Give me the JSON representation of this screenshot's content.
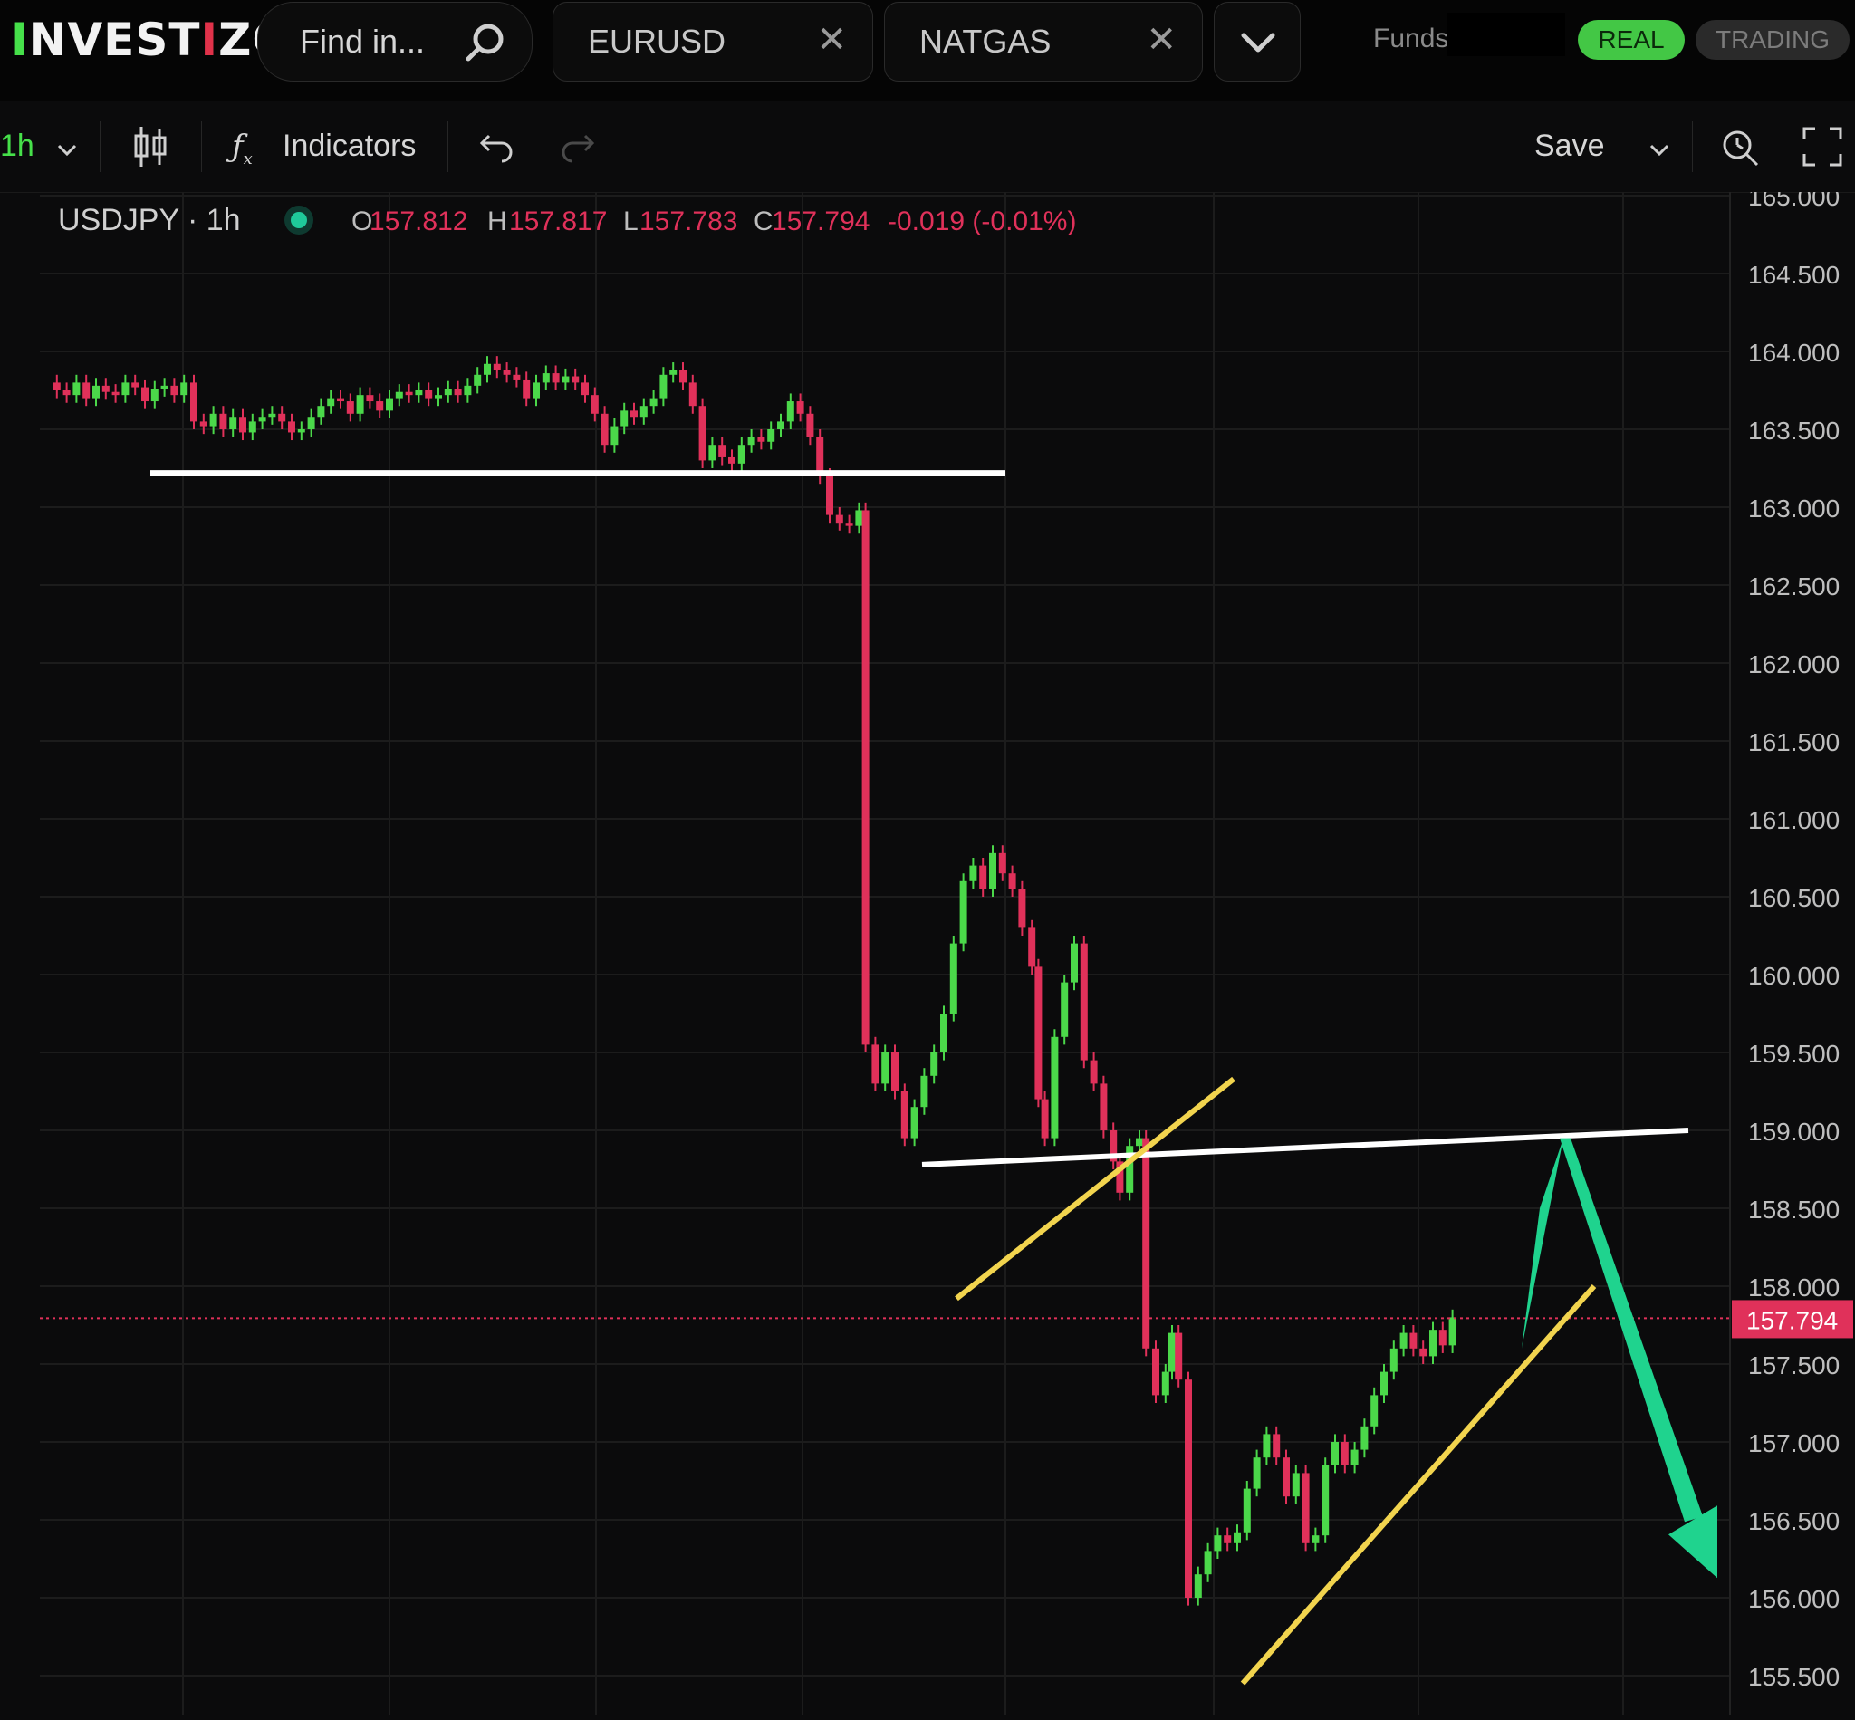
{
  "app": {
    "logo": "INVESTIZO"
  },
  "header": {
    "search_placeholder": "Find in...",
    "tabs": [
      {
        "label": "EURUSD"
      },
      {
        "label": "NATGAS"
      }
    ],
    "funds_label": "Funds",
    "real_label": "REAL",
    "trading_label": "TRADING"
  },
  "toolbar": {
    "interval": "1h",
    "indicators_label": "Indicators",
    "save_label": "Save"
  },
  "legend": {
    "symbol": "USDJPY · 1h",
    "o_label": "O",
    "o": "157.812",
    "h_label": "H",
    "h": "157.817",
    "l_label": "L",
    "l": "157.783",
    "c_label": "C",
    "c": "157.794",
    "change": "-0.019 (-0.01%)"
  },
  "colors": {
    "up": "#4bd84a",
    "down": "#e0315a",
    "grid": "#1c1c1c",
    "axis_text": "#bfbfbf",
    "price_tag": "#e0315a",
    "annotation_white": "#ffffff",
    "annotation_yellow": "#f2d44e",
    "annotation_arrow": "#1fd38e"
  },
  "chart_data": {
    "type": "candlestick",
    "symbol": "USDJPY",
    "interval": "1h",
    "ylim": [
      155.4,
      165.0
    ],
    "y_ticks": [
      "155.500",
      "156.000",
      "156.500",
      "157.000",
      "157.500",
      "158.000",
      "158.500",
      "159.000",
      "159.500",
      "160.000",
      "160.500",
      "161.000",
      "161.500",
      "162.000",
      "162.500",
      "163.000",
      "163.500",
      "164.000",
      "164.500",
      "165.000"
    ],
    "last_price": "157.794",
    "ohlc_path": [
      [
        0,
        163.8
      ],
      [
        6,
        163.75
      ],
      [
        12,
        163.72
      ],
      [
        18,
        163.8
      ],
      [
        24,
        163.7
      ],
      [
        30,
        163.78
      ],
      [
        36,
        163.74
      ],
      [
        42,
        163.72
      ],
      [
        48,
        163.8
      ],
      [
        54,
        163.77
      ],
      [
        60,
        163.68
      ],
      [
        66,
        163.76
      ],
      [
        72,
        163.78
      ],
      [
        78,
        163.72
      ],
      [
        84,
        163.8
      ],
      [
        90,
        163.55
      ],
      [
        96,
        163.52
      ],
      [
        102,
        163.6
      ],
      [
        108,
        163.5
      ],
      [
        114,
        163.58
      ],
      [
        120,
        163.48
      ],
      [
        126,
        163.55
      ],
      [
        132,
        163.58
      ],
      [
        138,
        163.6
      ],
      [
        144,
        163.55
      ],
      [
        150,
        163.48
      ],
      [
        156,
        163.5
      ],
      [
        162,
        163.58
      ],
      [
        168,
        163.65
      ],
      [
        174,
        163.7
      ],
      [
        180,
        163.68
      ],
      [
        186,
        163.6
      ],
      [
        192,
        163.72
      ],
      [
        198,
        163.68
      ],
      [
        204,
        163.62
      ],
      [
        210,
        163.7
      ],
      [
        216,
        163.74
      ],
      [
        222,
        163.72
      ],
      [
        228,
        163.75
      ],
      [
        234,
        163.7
      ],
      [
        240,
        163.72
      ],
      [
        246,
        163.76
      ],
      [
        252,
        163.72
      ],
      [
        258,
        163.78
      ],
      [
        264,
        163.85
      ],
      [
        270,
        163.92
      ],
      [
        276,
        163.88
      ],
      [
        282,
        163.85
      ],
      [
        288,
        163.82
      ],
      [
        294,
        163.7
      ],
      [
        300,
        163.8
      ],
      [
        306,
        163.86
      ],
      [
        312,
        163.8
      ],
      [
        318,
        163.84
      ],
      [
        324,
        163.8
      ],
      [
        330,
        163.72
      ],
      [
        336,
        163.6
      ],
      [
        342,
        163.4
      ],
      [
        348,
        163.52
      ],
      [
        354,
        163.62
      ],
      [
        360,
        163.58
      ],
      [
        366,
        163.65
      ],
      [
        372,
        163.7
      ],
      [
        378,
        163.85
      ],
      [
        384,
        163.88
      ],
      [
        390,
        163.8
      ],
      [
        396,
        163.65
      ],
      [
        402,
        163.3
      ],
      [
        408,
        163.4
      ],
      [
        414,
        163.32
      ],
      [
        420,
        163.28
      ],
      [
        426,
        163.4
      ],
      [
        432,
        163.45
      ],
      [
        438,
        163.42
      ],
      [
        444,
        163.5
      ],
      [
        450,
        163.55
      ],
      [
        456,
        163.68
      ],
      [
        462,
        163.6
      ],
      [
        468,
        163.45
      ],
      [
        474,
        163.2
      ],
      [
        480,
        162.95
      ],
      [
        486,
        162.9
      ],
      [
        492,
        162.88
      ],
      [
        498,
        162.98
      ],
      [
        502,
        159.55
      ],
      [
        508,
        159.3
      ],
      [
        514,
        159.5
      ],
      [
        520,
        159.25
      ],
      [
        526,
        158.95
      ],
      [
        532,
        159.15
      ],
      [
        538,
        159.35
      ],
      [
        544,
        159.5
      ],
      [
        550,
        159.75
      ],
      [
        556,
        160.2
      ],
      [
        562,
        160.6
      ],
      [
        568,
        160.7
      ],
      [
        574,
        160.55
      ],
      [
        580,
        160.78
      ],
      [
        586,
        160.65
      ],
      [
        592,
        160.55
      ],
      [
        598,
        160.3
      ],
      [
        604,
        160.05
      ],
      [
        608,
        159.2
      ],
      [
        612,
        158.95
      ],
      [
        618,
        159.6
      ],
      [
        624,
        159.95
      ],
      [
        630,
        160.2
      ],
      [
        636,
        159.45
      ],
      [
        642,
        159.3
      ],
      [
        648,
        159.0
      ],
      [
        654,
        158.8
      ],
      [
        658,
        158.6
      ],
      [
        664,
        158.9
      ],
      [
        670,
        158.95
      ],
      [
        674,
        157.6
      ],
      [
        680,
        157.3
      ],
      [
        686,
        157.45
      ],
      [
        690,
        157.7
      ],
      [
        694,
        157.4
      ],
      [
        700,
        156.0
      ],
      [
        706,
        156.15
      ],
      [
        712,
        156.3
      ],
      [
        718,
        156.4
      ],
      [
        724,
        156.35
      ],
      [
        730,
        156.42
      ],
      [
        736,
        156.7
      ],
      [
        742,
        156.9
      ],
      [
        748,
        157.05
      ],
      [
        754,
        156.9
      ],
      [
        760,
        156.65
      ],
      [
        766,
        156.8
      ],
      [
        772,
        156.35
      ],
      [
        778,
        156.4
      ],
      [
        784,
        156.85
      ],
      [
        790,
        157.0
      ],
      [
        796,
        156.85
      ],
      [
        802,
        156.95
      ],
      [
        808,
        157.1
      ],
      [
        814,
        157.3
      ],
      [
        820,
        157.45
      ],
      [
        826,
        157.6
      ],
      [
        832,
        157.7
      ],
      [
        838,
        157.6
      ],
      [
        844,
        157.55
      ],
      [
        850,
        157.72
      ],
      [
        856,
        157.62
      ],
      [
        862,
        157.8
      ]
    ],
    "annotations": [
      {
        "type": "hline",
        "color": "white",
        "price": 163.22
      },
      {
        "type": "trendline",
        "color": "white",
        "from_price": 158.78,
        "to_price": 159.0
      },
      {
        "type": "trendline",
        "color": "yellow",
        "from_price": 157.92,
        "to_price": 159.33
      },
      {
        "type": "trendline",
        "color": "yellow",
        "from_price": 155.45,
        "to_price": 158.0
      },
      {
        "type": "arrow",
        "color": "green",
        "direction": "up-then-down",
        "peak_price": 158.95,
        "end_price": 156.15
      }
    ]
  }
}
